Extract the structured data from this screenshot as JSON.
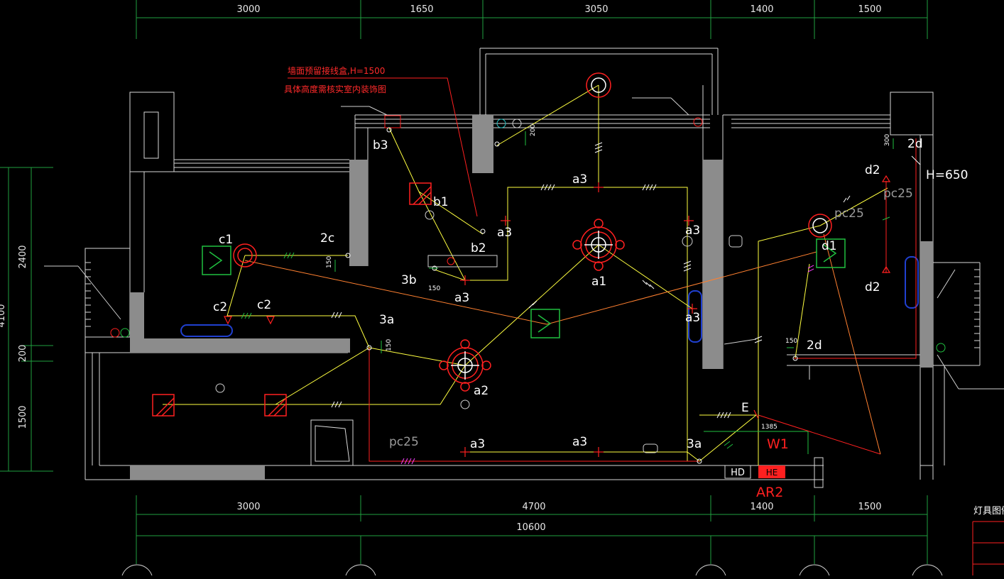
{
  "dims": {
    "top": [
      "3000",
      "1650",
      "3050",
      "1400",
      "1500"
    ],
    "bottom": [
      "3000",
      "4700",
      "1400",
      "1500"
    ],
    "total": "10600",
    "left": [
      "2400",
      "4100",
      "200",
      "1500"
    ]
  },
  "notes": {
    "line1": "墙面预留接线盒,H=1500",
    "line2": "具体高度需核实室内装饰图"
  },
  "labels": {
    "b3": "b3",
    "b1": "b1",
    "b2": "b2",
    "a3": "a3",
    "a1": "a1",
    "a2": "a2",
    "c1": "c1",
    "c2": "c2",
    "2c": "2c",
    "3b": "3b",
    "3a": "3a",
    "d1": "d1",
    "d2": "d2",
    "2d": "2d",
    "E": "E",
    "W1": "W1",
    "AR2": "AR2",
    "HD": "HD",
    "HE": "HE",
    "pc25": "pc25",
    "H650": "H=650"
  },
  "small": {
    "s200": "200",
    "s150": "150",
    "s1385": "1385",
    "s300": "300"
  },
  "legend_title": "灯具图例",
  "colors": {
    "wall": "#d8d8d8",
    "column": "#8c8c8c",
    "wire": "#ffff40",
    "red": "#ff2020",
    "orange": "#ff8030",
    "green": "#20c040",
    "dim": "#20a040",
    "blue": "#2040d0",
    "pink": "#ff40ff"
  }
}
